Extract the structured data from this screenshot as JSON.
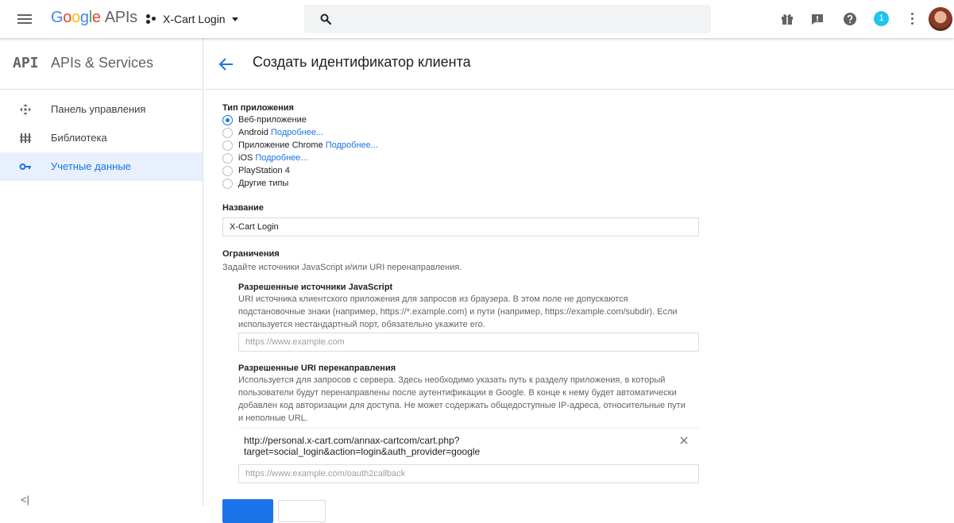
{
  "topbar": {
    "logo_google": "Google",
    "logo_apis": "APIs",
    "project_name": "X-Cart Login",
    "search_placeholder": "",
    "notification_count": "1",
    "icons": [
      "menu-icon",
      "project-icon",
      "search-icon",
      "gift-icon",
      "feedback-icon",
      "help-icon",
      "notifications-icon",
      "more-vert-icon",
      "avatar"
    ]
  },
  "sidebar": {
    "badge": "API",
    "title": "APIs & Services",
    "items": [
      {
        "label": "Панель управления",
        "icon": "dashboard-icon",
        "active": false
      },
      {
        "label": "Библиотека",
        "icon": "library-icon",
        "active": false
      },
      {
        "label": "Учетные данные",
        "icon": "key-icon",
        "active": true
      }
    ],
    "collapse_label": "<|"
  },
  "page": {
    "title": "Создать идентификатор клиента"
  },
  "form": {
    "app_type_label": "Тип приложения",
    "app_types": [
      {
        "label": "Веб-приложение",
        "link": "",
        "checked": true
      },
      {
        "label": "Android",
        "link": "Подробнее...",
        "checked": false
      },
      {
        "label": "Приложение Chrome",
        "link": "Подробнее...",
        "checked": false
      },
      {
        "label": "iOS",
        "link": "Подробнее...",
        "checked": false
      },
      {
        "label": "PlayStation 4",
        "link": "",
        "checked": false
      },
      {
        "label": "Другие типы",
        "link": "",
        "checked": false
      }
    ],
    "name_label": "Название",
    "name_value": "X-Cart Login",
    "restrictions_label": "Ограничения",
    "restrictions_hint": "Задайте источники JavaScript и/или URI перенаправления.",
    "js_origins_label": "Разрешенные источники JavaScript",
    "js_origins_desc_1": "URI источника клиентского приложения для запросов из браузера. В этом поле не допускаются",
    "js_origins_desc_2": "подстановочные знаки (например, https://*.example.com) и пути (например, https://example.com/subdir). Если",
    "js_origins_desc_3": "используется нестандартный порт, обязательно укажите его.",
    "js_origins_placeholder": "https://www.example.com",
    "redirect_label": "Разрешенные URI перенаправления",
    "redirect_desc_1": "Используется для запросов с сервера. Здесь необходимо указать путь к разделу приложения, в который",
    "redirect_desc_2": "пользователи будут перенаправлены после аутентификации в Google. В конце к нему будет автоматически",
    "redirect_desc_3": "добавлен код авторизации для доступа. Не может содержать общедоступные IP-адреса, относительные пути",
    "redirect_desc_4": "и неполные URL.",
    "redirect_uri_line1": "http://personal.x-cart.com/annax-cartcom/cart.php?",
    "redirect_uri_line2": "target=social_login&action=login&auth_provider=google",
    "redirect_placeholder": "https://www.example.com/oauth2callback"
  },
  "colors": {
    "accent": "#1a73e8",
    "badge": "#1ec5ea",
    "active_bg": "#e8f0fe"
  }
}
